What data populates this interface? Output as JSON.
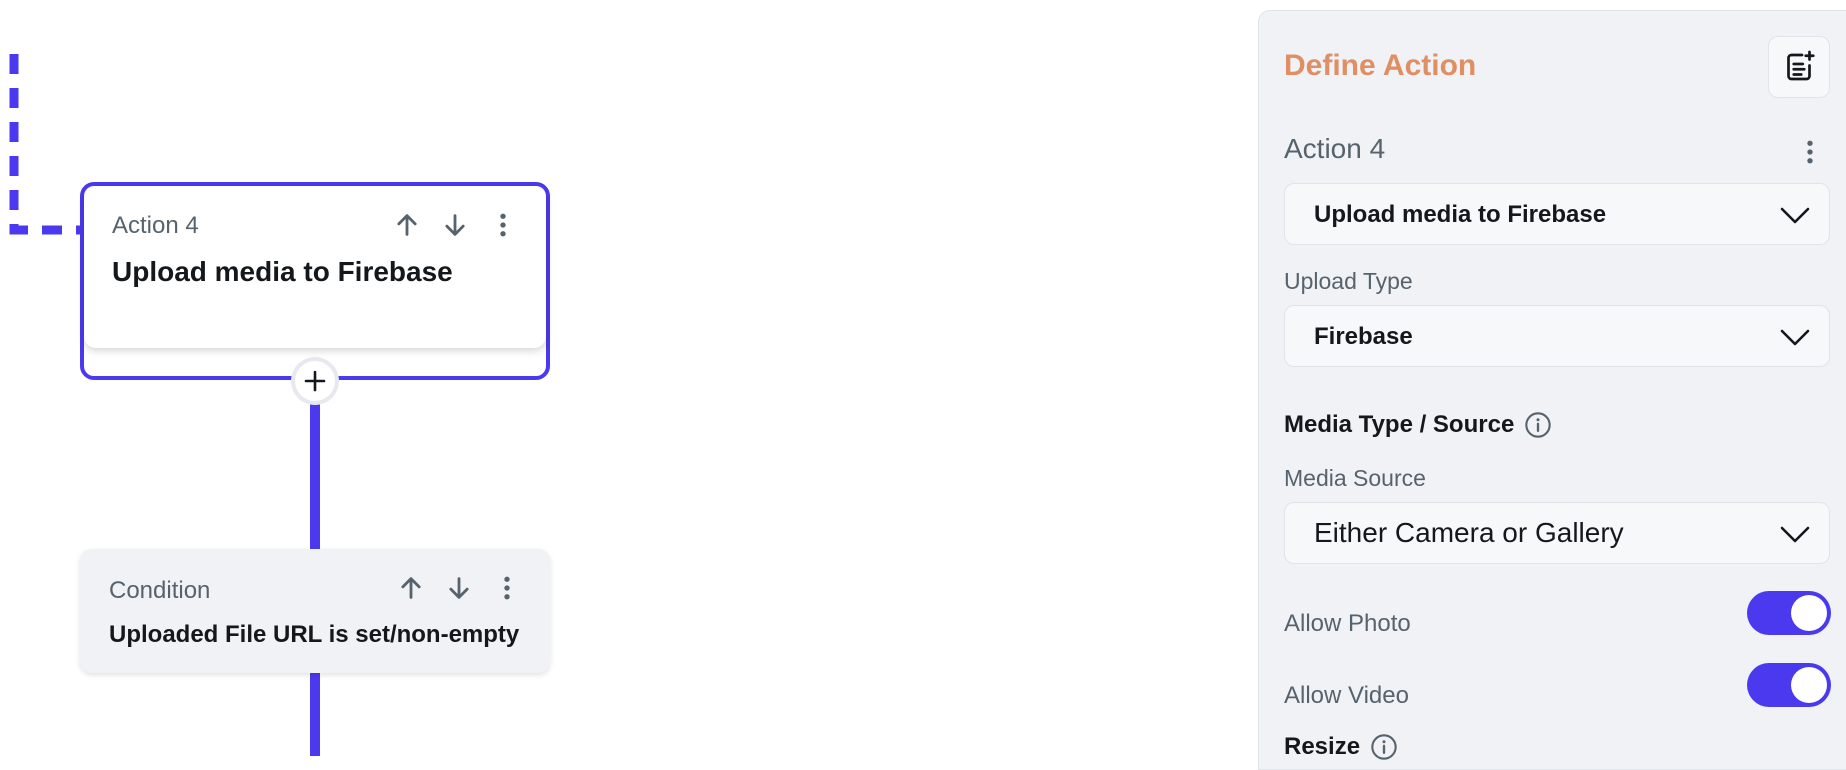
{
  "canvas": {
    "action_node": {
      "kind": "Action 4",
      "title": "Upload media to Firebase"
    },
    "condition_node": {
      "kind": "Condition",
      "title": "Uploaded File URL is set/non-empty"
    }
  },
  "panel": {
    "title": "Define Action",
    "action_name": "Action 4",
    "action_type": "Upload media to Firebase",
    "upload_type_label": "Upload Type",
    "upload_type_value": "Firebase",
    "media_section_label": "Media Type / Source",
    "media_source_label": "Media Source",
    "media_source_value": "Either Camera or Gallery",
    "allow_photo_label": "Allow Photo",
    "allow_photo_on": true,
    "allow_video_label": "Allow Video",
    "allow_video_on": true,
    "resize_label": "Resize"
  },
  "colors": {
    "accent": "#4b39ef",
    "panel_title": "#e08e63",
    "panel_bg": "#f1f2f6",
    "muted_text": "#57636c"
  }
}
